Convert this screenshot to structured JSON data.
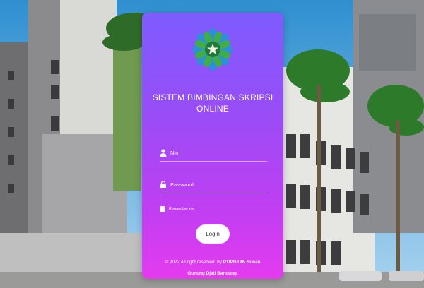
{
  "login": {
    "title_line1": "SISTEM BIMBINGAN SKRIPSI",
    "title_line2": "ONLINE",
    "nim_placeholder": "Nim",
    "password_placeholder": "Password",
    "remember_label": "Remember me",
    "login_label": "Login",
    "footer_prefix": "© 2022 All right reserved. by ",
    "footer_org_1": "PTIPD UIN Sunan",
    "footer_org_2": "Gunung Djati Bandung."
  },
  "colors": {
    "gradient_top": "#7d5cff",
    "gradient_bottom": "#e53bef",
    "logo_green": "#3fae49",
    "logo_blue": "#2d8fd6"
  },
  "icons": {
    "logo": "uin-star-logo",
    "nim": "user-icon",
    "password": "lock-icon"
  }
}
